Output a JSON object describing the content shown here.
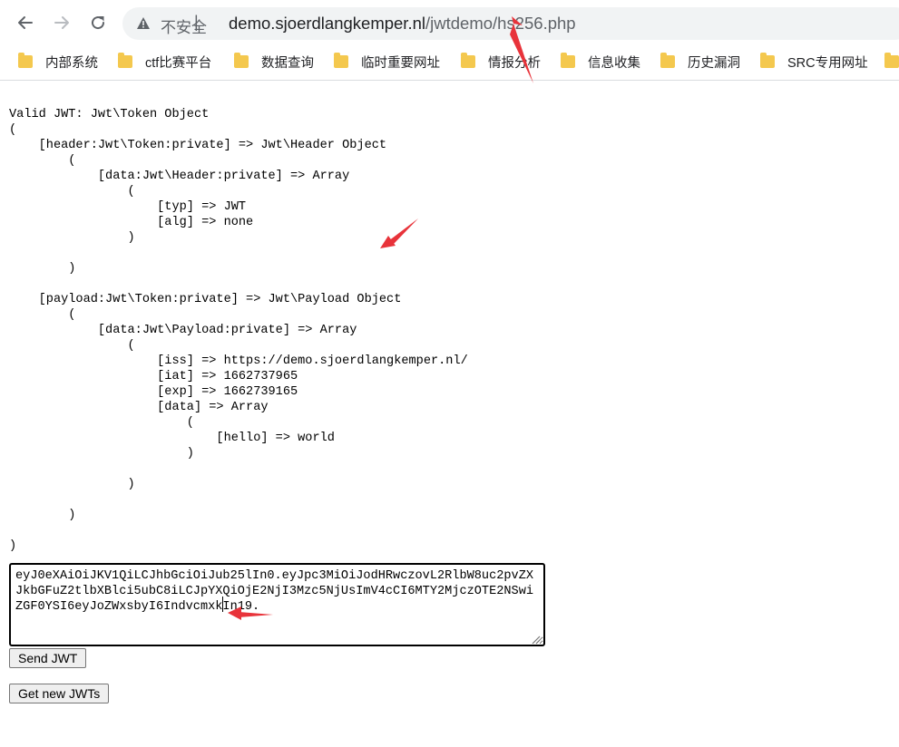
{
  "browser": {
    "back_icon": "arrow-left-icon",
    "forward_icon": "arrow-right-icon",
    "reload_icon": "reload-icon",
    "security_icon": "warning-triangle-icon",
    "security_text": "不安全",
    "separator": "|",
    "url_host": "demo.sjoerdlangkemper.nl",
    "url_path": "/jwtdemo/hs256.php"
  },
  "bookmarks": [
    {
      "label": "内部系统"
    },
    {
      "label": "ctf比赛平台"
    },
    {
      "label": "数据查询"
    },
    {
      "label": "临时重要网址"
    },
    {
      "label": "情报分析"
    },
    {
      "label": "信息收集"
    },
    {
      "label": "历史漏洞"
    },
    {
      "label": "SRC专用网址"
    }
  ],
  "page": {
    "dump_text": "Valid JWT: Jwt\\Token Object\n(\n    [header:Jwt\\Token:private] => Jwt\\Header Object\n        (\n            [data:Jwt\\Header:private] => Array\n                (\n                    [typ] => JWT\n                    [alg] => none\n                )\n\n        )\n\n    [payload:Jwt\\Token:private] => Jwt\\Payload Object\n        (\n            [data:Jwt\\Payload:private] => Array\n                (\n                    [iss] => https://demo.sjoerdlangkemper.nl/\n                    [iat] => 1662737965\n                    [exp] => 1662739165\n                    [data] => Array\n                        (\n                            [hello] => world\n                        )\n\n                )\n\n        )\n\n)",
    "jwt_value": "eyJ0eXAiOiJKV1QiLCJhbGciOiJub25lIn0.eyJpc3MiOiJodHRwczovL2RlbW8uc2pvZXJkbGFuZ2tlbXBlci5ubC8iLCJpYXQiOjE2NjI3Mzc5NjUsImV4cCI6MTY2MjczOTE2NSwiZGF0YSI6eyJoZWxsbyI6IndvcmxkIn19.",
    "send_button": "Send JWT",
    "new_button": "Get new JWTs"
  },
  "colors": {
    "annotation_arrow": "#e8333a",
    "folder": "#f4c84e",
    "omnibox": "#f1f3f4"
  }
}
